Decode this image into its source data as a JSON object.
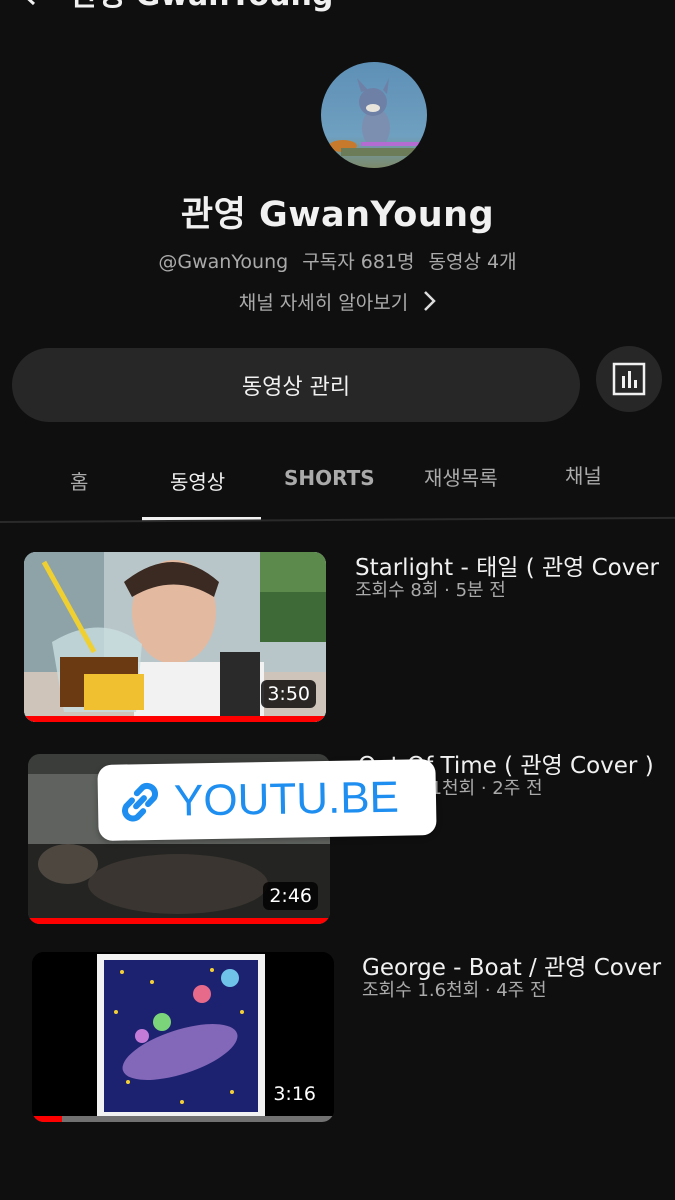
{
  "header": {
    "title": "관영 GwanYoung",
    "back_icon": "back-arrow-icon",
    "cast_icon": "cast-icon",
    "search_icon": "search-icon"
  },
  "channel": {
    "name": "관영 GwanYoung",
    "handle": "@GwanYoung",
    "subscribers": "구독자 681명",
    "video_count": "동영상 4개",
    "about_label": "채널 자세히 알아보기"
  },
  "actions": {
    "manage_videos_label": "동영상 관리",
    "stats_icon": "analytics-icon"
  },
  "tabs": [
    {
      "label": "홈",
      "active": false
    },
    {
      "label": "동영상",
      "active": true
    },
    {
      "label": "SHORTS",
      "active": false
    },
    {
      "label": "재생목록",
      "active": false
    },
    {
      "label": "채널",
      "active": false
    }
  ],
  "videos": [
    {
      "title": "Starlight - 태일 ( 관영 Cover",
      "meta": "조회수 8회 · 5분 전",
      "duration": "3:50",
      "watched": 1.0
    },
    {
      "title": "Out Of Time ( 관영 Cover )",
      "meta": "조회수 1.1천회 · 2주 전",
      "duration": "2:46",
      "watched": 1.0
    },
    {
      "title": "George - Boat / 관영 Cover",
      "meta": "조회수 1.6천회 · 4주 전",
      "duration": "3:16",
      "watched": 0.1
    }
  ],
  "sticker": {
    "label": "YOUTU.BE",
    "icon": "link-icon"
  },
  "colors": {
    "background": "#0f0f0f",
    "progress": "#ff0000",
    "sticker_text": "#1e8ef0"
  }
}
